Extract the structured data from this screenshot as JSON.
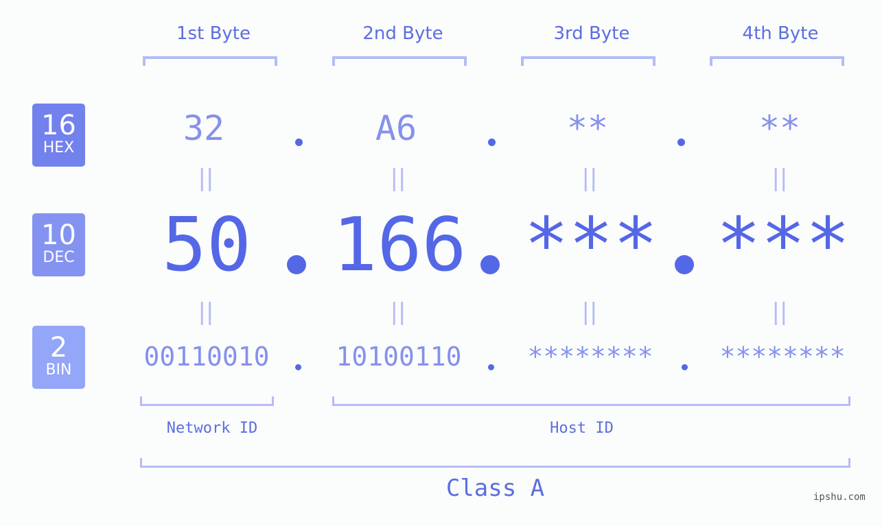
{
  "colors": {
    "hex_badge": "#7281ec",
    "dec_badge": "#8493f0",
    "bin_badge": "#93a6f7",
    "accent": "#5467e6",
    "light": "#b3bcf5"
  },
  "badges": [
    {
      "num": "16",
      "label": "HEX"
    },
    {
      "num": "10",
      "label": "DEC"
    },
    {
      "num": "2",
      "label": "BIN"
    }
  ],
  "headers": [
    "1st Byte",
    "2nd Byte",
    "3rd Byte",
    "4th Byte"
  ],
  "hex": [
    "32",
    "A6",
    "**",
    "**"
  ],
  "dec": [
    "50",
    "166",
    "***",
    "***"
  ],
  "bin": [
    "00110010",
    "10100110",
    "********",
    "********"
  ],
  "equals": "||",
  "network_label": "Network ID",
  "host_label": "Host ID",
  "class_label": "Class A",
  "watermark": "ipshu.com"
}
